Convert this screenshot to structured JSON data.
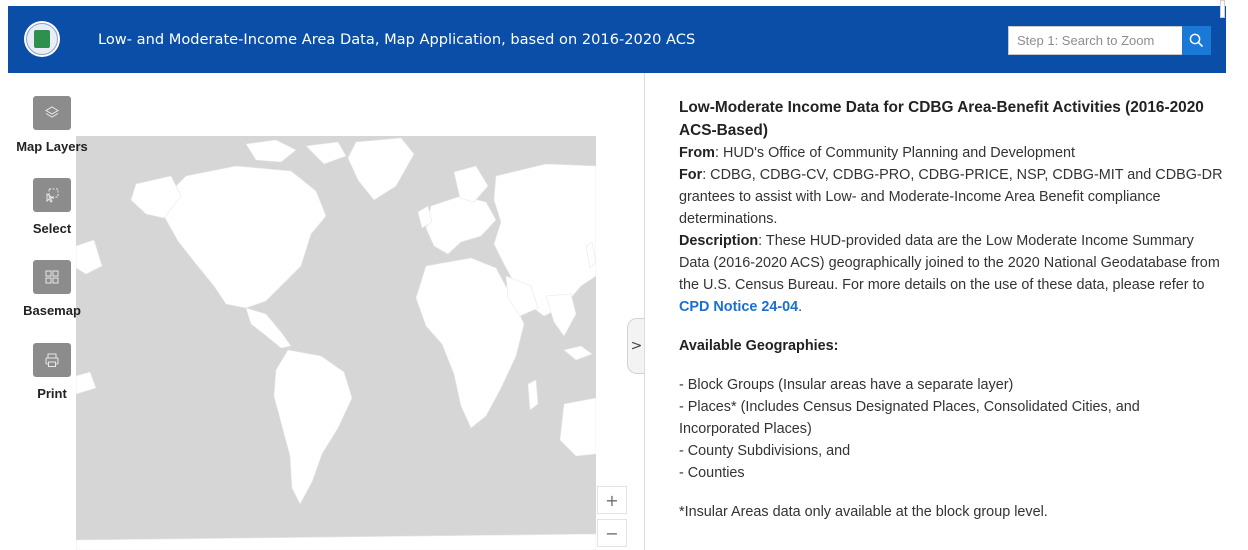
{
  "header": {
    "title": "Low- and Moderate-Income Area Data, Map Application, based on 2016-2020 ACS",
    "search_placeholder": "Step 1: Search to Zoom",
    "brand_color": "#0a4ea8",
    "accent_color": "#1a78d6",
    "logo_icon": "hud-seal-icon",
    "search_icon": "search-icon"
  },
  "tools": [
    {
      "label": "Map Layers",
      "icon": "layers-icon"
    },
    {
      "label": "Select",
      "icon": "select-icon"
    },
    {
      "label": "Basemap",
      "icon": "basemap-grid-icon"
    },
    {
      "label": "Print",
      "icon": "printer-icon"
    }
  ],
  "map": {
    "zoom_in": "+",
    "zoom_out": "−",
    "collapse": ">"
  },
  "panel": {
    "title": "Low-Moderate Income Data for CDBG Area-Benefit Activities (2016-2020 ACS-Based)",
    "from_label": "From",
    "from_text": ": HUD's Office of Community Planning and Development",
    "for_label": "For",
    "for_text": ": CDBG, CDBG-CV, CDBG-PRO, CDBG-PRICE, NSP, CDBG-MIT and CDBG-DR grantees to assist with Low- and Moderate-Income Area Benefit compliance determinations.",
    "desc_label": "Description",
    "desc_text": ":  These HUD-provided data are the Low Moderate Income Summary Data (2016-2020 ACS) geographically joined to the 2020 National Geodatabase from the U.S. Census Bureau.  For more details on the use of these data, please refer to ",
    "link_text": "CPD Notice 24-04",
    "desc_end": ".",
    "geographies_heading": "Available Geographies:",
    "geographies": [
      "- Block Groups (Insular areas have a separate layer)",
      "- Places* (Includes Census Designated Places, Consolidated Cities, and Incorporated Places)",
      "- County Subdivisions, and",
      "- Counties"
    ],
    "note": "*Insular Areas data only available at the block group level."
  }
}
